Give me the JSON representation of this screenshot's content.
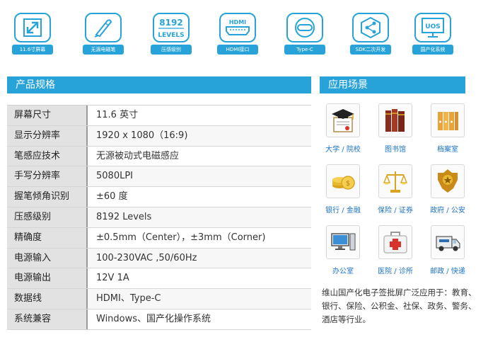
{
  "features": [
    {
      "icon": "expand-arrow-icon",
      "label": "11.6寸屏幕"
    },
    {
      "icon": "pen-icon",
      "label": "无源电磁笔"
    },
    {
      "icon": "pressure-levels-icon",
      "icon_text_top": "8192",
      "icon_text_bottom": "LEVELS",
      "label": "压感级别"
    },
    {
      "icon": "hdmi-icon",
      "icon_text_top": "HDMI",
      "label": "HDMI接口"
    },
    {
      "icon": "type-c-icon",
      "label": "Type-C"
    },
    {
      "icon": "sdk-share-icon",
      "label": "SDK二次开发"
    },
    {
      "icon": "uos-monitor-icon",
      "icon_text_top": "UOS",
      "label": "国产化系统"
    }
  ],
  "sections": {
    "specs_title": "产品规格",
    "scenes_title": "应用场景"
  },
  "specs": [
    {
      "label": "屏幕尺寸",
      "value": "11.6 英寸"
    },
    {
      "label": "显示分辨率",
      "value": "1920 x 1080（16:9)"
    },
    {
      "label": "笔感应技术",
      "value": "无源被动式电磁感应"
    },
    {
      "label": "手写分辨率",
      "value": "5080LPI"
    },
    {
      "label": "握笔倾角识别",
      "value": "±60 度"
    },
    {
      "label": "压感级别",
      "value": "8192 Levels"
    },
    {
      "label": "精确度",
      "value": "±0.5mm（Center），±3mm（Corner)"
    },
    {
      "label": "电源输入",
      "value": "100-230VAC ,50/60Hz"
    },
    {
      "label": "电源输出",
      "value": "12V 1A"
    },
    {
      "label": "数据线",
      "value": "HDMI、Type-C"
    },
    {
      "label": "系统兼容",
      "value": "Windows、国产化操作系统"
    }
  ],
  "scenes": [
    {
      "icon": "graduation-cap-icon",
      "label": "大学 / 院校"
    },
    {
      "icon": "books-icon",
      "label": "图书馆"
    },
    {
      "icon": "file-cabinet-icon",
      "label": "档案室"
    },
    {
      "icon": "gold-coins-icon",
      "label": "银行 / 金融"
    },
    {
      "icon": "scales-icon",
      "label": "保险 / 证券"
    },
    {
      "icon": "police-badge-icon",
      "label": "政府 / 公安"
    },
    {
      "icon": "computer-icon",
      "label": "办公室"
    },
    {
      "icon": "first-aid-kit-icon",
      "label": "医院 / 诊所"
    },
    {
      "icon": "delivery-truck-icon",
      "label": "邮政 / 快递"
    }
  ],
  "scene_desc": "维山国产化电子签批屏广泛应用于：教育、银行、保险、公积金、社保、政务、警务、酒店等行业。",
  "colors": {
    "accent": "#27a3d9",
    "scene_label": "#1a73c6"
  }
}
